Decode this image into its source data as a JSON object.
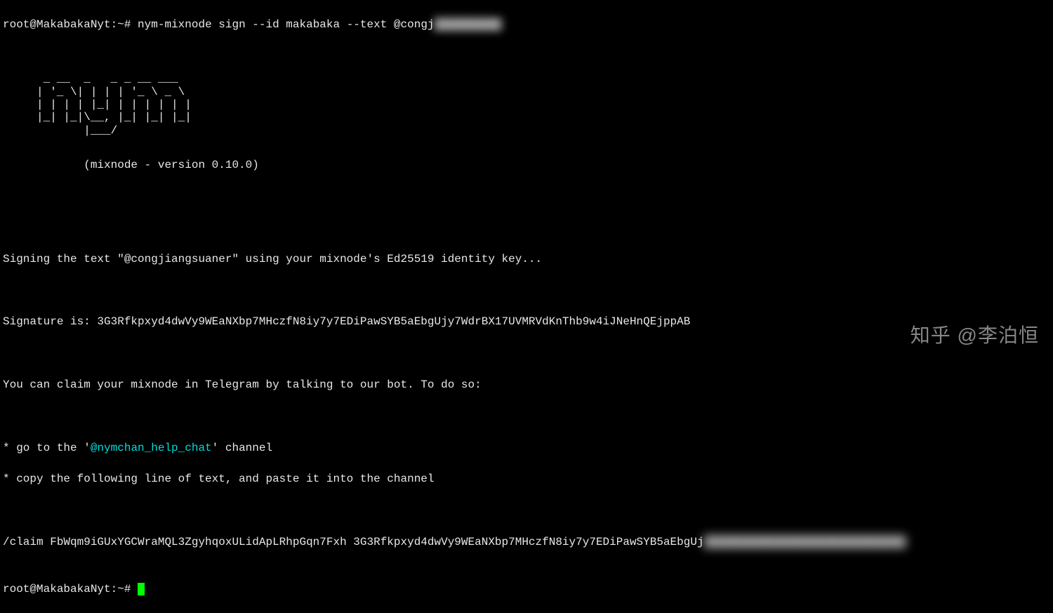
{
  "prompt1": {
    "user_host": "root@MakabakaNyt",
    "sep": ":",
    "path": "~",
    "hash": "# ",
    "command": "nym-mixnode sign --id makabaka --text @congj",
    "obscured": "██████████"
  },
  "ascii_art": "      _ __  _   _ _ __ ___\n     | '_ \\| | | | '_ \\ _ \\\n     | | | | |_| | | | | | |\n     |_| |_|\\__, |_| |_| |_|\n            |___/",
  "version_line": "            (mixnode - version 0.10.0)",
  "signing_line": "Signing the text \"@congjiangsuaner\" using your mixnode's Ed25519 identity key...",
  "signature_line": "Signature is: 3G3Rfkpxyd4dwVy9WEaNXbp7MHczfN8iy7y7EDiPawSYB5aEbgUjy7WdrBX17UVMRVdKnThb9w4iJNeHnQEjppAB",
  "claim_intro": "You can claim your mixnode in Telegram by talking to our bot. To do so:",
  "bullet1_prefix": "* go to the '",
  "bullet1_link": "@nymchan_help_chat",
  "bullet1_suffix": "' channel",
  "bullet2": "* copy the following line of text, and paste it into the channel",
  "claim_line": "/claim FbWqm9iGUxYGCWraMQL3ZgyhqoxULidApLRhpGqn7Fxh 3G3Rfkpxyd4dwVy9WEaNXbp7MHczfN8iy7y7EDiPawSYB5aEbgUj",
  "claim_obscured": "██████████████████████████████",
  "prompt2": {
    "user_host": "root@MakabakaNyt",
    "sep": ":",
    "path": "~",
    "hash": "# "
  },
  "watermark": "知乎 @李泊恒"
}
